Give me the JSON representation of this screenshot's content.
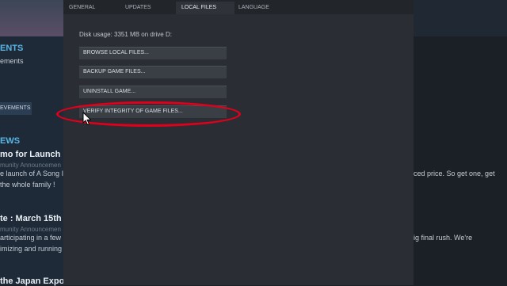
{
  "background_left": {
    "section_heading": "ENTS",
    "section_line": "ements",
    "achievements_button": "EVEMENTS",
    "news_heading": "EWS",
    "news": [
      {
        "title": "mo for Launch",
        "subtitle": "munity Announcemen",
        "line1": "e launch of A Song I",
        "line2": "the whole family !"
      },
      {
        "title": "te : March 15th",
        "subtitle": "munity Announcemen",
        "line1": "articipating in a few",
        "line2": "imizing and running"
      },
      {
        "title": "the Japan Expo"
      }
    ]
  },
  "background_right": {
    "line1": "ced price. So get one, get",
    "line2": "ig final rush. We're"
  },
  "tabs": [
    {
      "label": "GENERAL",
      "active": false
    },
    {
      "label": "UPDATES",
      "active": false
    },
    {
      "label": "LOCAL FILES",
      "active": true
    },
    {
      "label": "LANGUAGE",
      "active": false
    }
  ],
  "disk_usage": "Disk usage: 3351 MB on drive D:",
  "buttons": {
    "browse": "BROWSE LOCAL FILES...",
    "backup": "BACKUP GAME FILES...",
    "uninstall": "UNINSTALL GAME...",
    "verify": "VERIFY INTEGRITY OF GAME FILES..."
  },
  "colors": {
    "highlight": "#e0001b",
    "accent": "#59b6e6"
  },
  "icons": {
    "cursor": "mouse-pointer-icon"
  }
}
